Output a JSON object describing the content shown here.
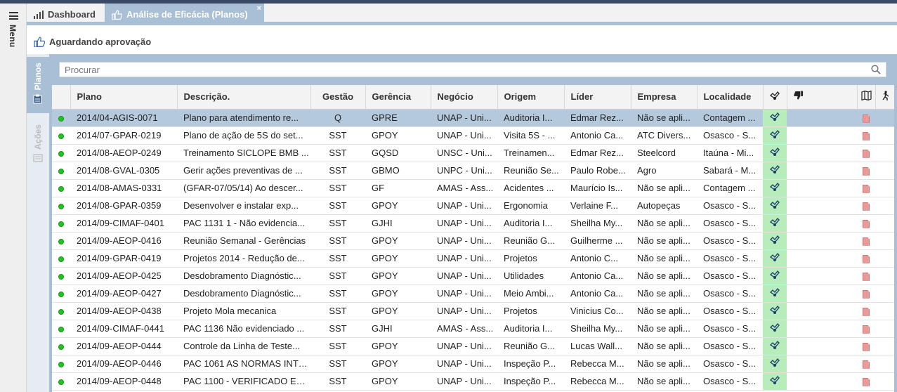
{
  "sidebar": {
    "menu_label": "Menu"
  },
  "tabs": [
    {
      "label": "Dashboard",
      "icon": "bar-chart-icon"
    },
    {
      "label": "Análise de Eficácia (Planos)",
      "icon": "thumbs-up-icon",
      "close": "×"
    }
  ],
  "status": {
    "label": "Aguardando aprovação",
    "icon": "thumbs-up-icon"
  },
  "side_tabs": [
    {
      "label": "Planos",
      "icon": "clipboard-icon"
    },
    {
      "label": "Ações",
      "icon": "list-icon"
    }
  ],
  "search": {
    "placeholder": "Procurar",
    "icon": "search-icon"
  },
  "columns": [
    "Plano",
    "Descrição.",
    "Gestão",
    "Gerência",
    "Negócio",
    "Origem",
    "Líder",
    "Empresa",
    "Localidade"
  ],
  "column_icons": [
    "effective-icon",
    "not-effective-icon",
    "map-icon",
    "run-icon"
  ],
  "rows": [
    {
      "plano": "2014/04-AGIS-0071",
      "descricao": "Plano para atendimento re...",
      "gestao": "Q",
      "gerencia": "GPRE",
      "negocio": "UNAP - Uni...",
      "origem": "Auditoria I...",
      "lider": "Edmar Rez...",
      "empresa": "Não se apli...",
      "localidade": "Contagem ...",
      "selected": true
    },
    {
      "plano": "2014/07-GPAR-0219",
      "descricao": "Plano de ação de 5S do set...",
      "gestao": "SST",
      "gerencia": "GPOY",
      "negocio": "UNAP - Uni...",
      "origem": "Visita 5S - ...",
      "lider": "Antonio Ca...",
      "empresa": "ATC Divers...",
      "localidade": "Osasco - S..."
    },
    {
      "plano": "2014/08-AEOP-0249",
      "descricao": "Treinamento SICLOPE BMB ...",
      "gestao": "SST",
      "gerencia": "GQSD",
      "negocio": "UNSC - Uni...",
      "origem": "Treinamen...",
      "lider": "Edmar Rez...",
      "empresa": "Steelcord",
      "localidade": "Itaúna - Mi..."
    },
    {
      "plano": "2014/08-GVAL-0305",
      "descricao": "Gerir ações preventivas de ...",
      "gestao": "SST",
      "gerencia": "GBMO",
      "negocio": "UNPC - Uni...",
      "origem": "Reunião Se...",
      "lider": "Paulo Robe...",
      "empresa": "Agro",
      "localidade": "Sabará - M..."
    },
    {
      "plano": "2014/08-AMAS-0331",
      "descricao": "(GFAR-07/05/14) Ao descer...",
      "gestao": "SST",
      "gerencia": "GF",
      "negocio": "AMAS - Ass...",
      "origem": "Acidentes ...",
      "lider": "Maurício Is...",
      "empresa": "Não se apli...",
      "localidade": "Contagem ..."
    },
    {
      "plano": "2014/08-GPAR-0359",
      "descricao": "Desenvolver e instalar exp...",
      "gestao": "SST",
      "gerencia": "GPOY",
      "negocio": "UNAP - Uni...",
      "origem": "Ergonomia",
      "lider": "Verlaine F...",
      "empresa": "Autopeças",
      "localidade": "Osasco - S..."
    },
    {
      "plano": "2014/09-CIMAF-0401",
      "descricao": "PAC 1131 1 - Não evidencia...",
      "gestao": "SST",
      "gerencia": "GJHI",
      "negocio": "UNAP - Uni...",
      "origem": "Auditoria I...",
      "lider": "Sheilha My...",
      "empresa": "Não se apli...",
      "localidade": "Osasco - S..."
    },
    {
      "plano": "2014/09-AEOP-0416",
      "descricao": "Reunião Semanal - Gerências",
      "gestao": "SST",
      "gerencia": "GPOY",
      "negocio": "UNAP - Uni...",
      "origem": "Reunião G...",
      "lider": "Guilherme ...",
      "empresa": "Não se apli...",
      "localidade": "Osasco - S..."
    },
    {
      "plano": "2014/09-GPAR-0419",
      "descricao": "Projetos 2014 - Redução de...",
      "gestao": "SST",
      "gerencia": "GPOY",
      "negocio": "UNAP - Uni...",
      "origem": "Projetos",
      "lider": "Antonio C...",
      "empresa": "Não se apli...",
      "localidade": "Osasco - S..."
    },
    {
      "plano": "2014/09-AEOP-0425",
      "descricao": "Desdobramento Diagnóstic...",
      "gestao": "SST",
      "gerencia": "GPOY",
      "negocio": "UNAP - Uni...",
      "origem": "Utilidades",
      "lider": "Antonio Ca...",
      "empresa": "Não se apli...",
      "localidade": "Osasco - S..."
    },
    {
      "plano": "2014/09-AEOP-0427",
      "descricao": "Desdobramento Diagnóstic...",
      "gestao": "SST",
      "gerencia": "GPOY",
      "negocio": "UNAP - Uni...",
      "origem": "Meio Ambi...",
      "lider": "Antonio Ca...",
      "empresa": "Não se apli...",
      "localidade": "Osasco - S..."
    },
    {
      "plano": "2014/09-AEOP-0438",
      "descricao": "Projeto Mola mecanica",
      "gestao": "SST",
      "gerencia": "GPOY",
      "negocio": "UNAP - Uni...",
      "origem": "Projetos",
      "lider": "Vinicius Co...",
      "empresa": "Não se apli...",
      "localidade": "Osasco - S..."
    },
    {
      "plano": "2014/09-CIMAF-0441",
      "descricao": "PAC 1136 Não evidenciado ...",
      "gestao": "SST",
      "gerencia": "GJHI",
      "negocio": "AMAS - Ass...",
      "origem": "Auditoria I...",
      "lider": "Sheilha My...",
      "empresa": "Não se apli...",
      "localidade": "Osasco - S..."
    },
    {
      "plano": "2014/09-AEOP-0444",
      "descricao": "Controle da Linha de Teste...",
      "gestao": "SST",
      "gerencia": "GPOY",
      "negocio": "UNAP - Uni...",
      "origem": "Reunião G...",
      "lider": "Lucas Wall...",
      "empresa": "Não se apli...",
      "localidade": "Osasco - S..."
    },
    {
      "plano": "2014/09-AEOP-0446",
      "descricao": "PAC 1061 AS NORMAS INTE...",
      "gestao": "SST",
      "gerencia": "GPOY",
      "negocio": "UNAP - Uni...",
      "origem": "Inspeção P...",
      "lider": "Rebecca M...",
      "empresa": "Não se apli...",
      "localidade": "Osasco - S..."
    },
    {
      "plano": "2014/09-AEOP-0448",
      "descricao": "PAC 1100 - VERIFICADO ESC...",
      "gestao": "SST",
      "gerencia": "GPOY",
      "negocio": "UNAP - Uni...",
      "origem": "Inspeção P...",
      "lider": "Rebecca M...",
      "empresa": "Não se apli...",
      "localidade": "Osasco - S..."
    }
  ],
  "colors": {
    "accent": "#a9bfd6",
    "selected_row": "#b5c9dd",
    "status_green": "#22c322",
    "effective_cell": "#b7ecbb",
    "pdf": "#e79a9a"
  }
}
